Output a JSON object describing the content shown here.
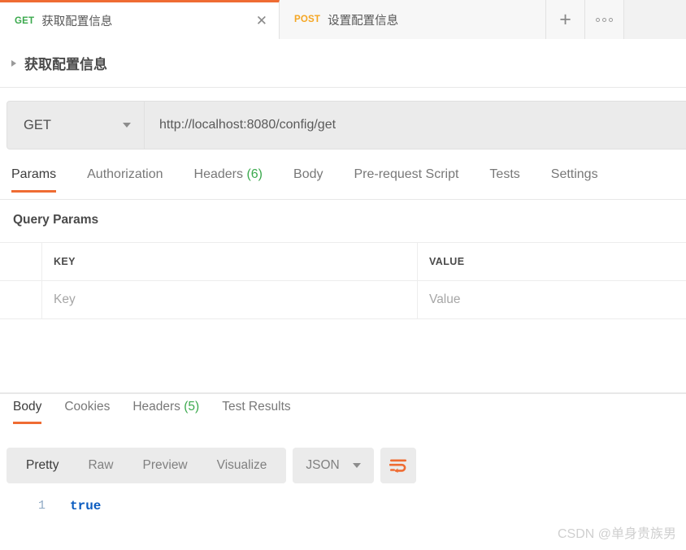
{
  "tabbar": {
    "tabs": [
      {
        "method": "GET",
        "name": "获取配置信息",
        "close_icon": "close-icon",
        "active": true
      },
      {
        "method": "POST",
        "name": "设置配置信息",
        "active": false
      }
    ],
    "new_tab_label": "+",
    "more_label": "ooo"
  },
  "breadcrumb": {
    "expand_icon": "caret-right-icon",
    "title": "获取配置信息"
  },
  "request": {
    "method": "GET",
    "method_caret_icon": "chevron-down-icon",
    "url": "http://localhost:8080/config/get",
    "tabs": [
      {
        "label": "Params",
        "count": "",
        "active": true
      },
      {
        "label": "Authorization",
        "count": "",
        "active": false
      },
      {
        "label": "Headers",
        "count": "(6)",
        "active": false
      },
      {
        "label": "Body",
        "count": "",
        "active": false
      },
      {
        "label": "Pre-request Script",
        "count": "",
        "active": false
      },
      {
        "label": "Tests",
        "count": "",
        "active": false
      },
      {
        "label": "Settings",
        "count": "",
        "active": false
      }
    ]
  },
  "query_params": {
    "section_title": "Query Params",
    "columns": [
      "KEY",
      "VALUE"
    ],
    "rows": [
      {
        "key_placeholder": "Key",
        "value_placeholder": "Value"
      }
    ]
  },
  "response": {
    "tabs": [
      {
        "label": "Body",
        "count": "",
        "active": true
      },
      {
        "label": "Cookies",
        "count": "",
        "active": false
      },
      {
        "label": "Headers",
        "count": "(5)",
        "active": false
      },
      {
        "label": "Test Results",
        "count": "",
        "active": false
      }
    ],
    "view_modes": [
      {
        "label": "Pretty",
        "active": true
      },
      {
        "label": "Raw",
        "active": false
      },
      {
        "label": "Preview",
        "active": false
      },
      {
        "label": "Visualize",
        "active": false
      }
    ],
    "format": "JSON",
    "format_caret_icon": "chevron-down-icon",
    "wrap_icon": "word-wrap-icon",
    "body": {
      "line_number": "1",
      "content": "true"
    }
  },
  "watermark": "CSDN @单身贵族男",
  "colors": {
    "accent": "#ef6c33",
    "get_green": "#3ba94d",
    "post_orange": "#f5a623",
    "count_green": "#3ba94d",
    "code_blue": "#0b5cc0"
  }
}
